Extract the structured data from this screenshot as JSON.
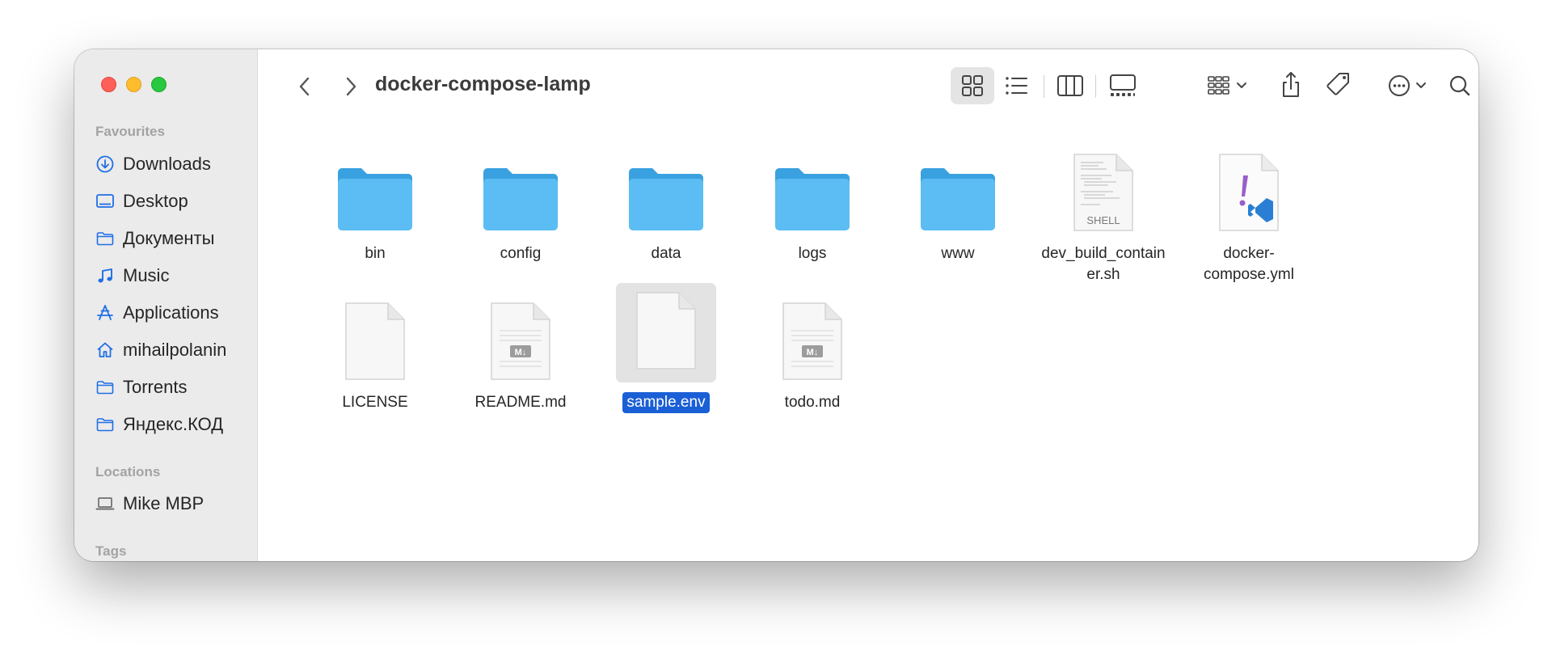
{
  "window": {
    "title": "docker-compose-lamp"
  },
  "sidebar": {
    "sections": [
      {
        "label": "Favourites"
      },
      {
        "label": "Locations"
      },
      {
        "label": "Tags"
      }
    ],
    "favourites": [
      {
        "label": "Downloads",
        "icon": "download-circle-icon"
      },
      {
        "label": "Desktop",
        "icon": "desktop-icon"
      },
      {
        "label": "Документы",
        "icon": "folder-icon"
      },
      {
        "label": "Music",
        "icon": "music-note-icon"
      },
      {
        "label": "Applications",
        "icon": "applications-icon"
      },
      {
        "label": "mihailpolanin",
        "icon": "home-icon"
      },
      {
        "label": "Torrents",
        "icon": "folder-icon"
      },
      {
        "label": "Яндекс.КОД",
        "icon": "folder-icon"
      }
    ],
    "locations": [
      {
        "label": "Mike MBP",
        "icon": "laptop-icon"
      }
    ]
  },
  "toolbar": {
    "icons": [
      "back-icon",
      "forward-icon",
      "icon-view-icon",
      "list-view-icon",
      "column-view-icon",
      "gallery-view-icon",
      "group-icon",
      "share-icon",
      "tag-icon",
      "more-icon",
      "search-icon"
    ],
    "active_view": "icon-view"
  },
  "files": [
    {
      "name": "bin",
      "kind": "folder"
    },
    {
      "name": "config",
      "kind": "folder"
    },
    {
      "name": "data",
      "kind": "folder"
    },
    {
      "name": "logs",
      "kind": "folder"
    },
    {
      "name": "www",
      "kind": "folder"
    },
    {
      "name": "dev_build_contain\ner.sh",
      "kind": "shell",
      "badge": "SHELL"
    },
    {
      "name": "docker-\ncompose.yml",
      "kind": "yml"
    },
    {
      "name": "LICENSE",
      "kind": "doc"
    },
    {
      "name": "README.md",
      "kind": "md",
      "badge": "M↓"
    },
    {
      "name": "sample.env",
      "kind": "doc",
      "selected": true
    },
    {
      "name": "todo.md",
      "kind": "md",
      "badge": "M↓"
    }
  ],
  "colors": {
    "folder": "#5bbdf3",
    "folder_tab": "#3aa1e0",
    "selection": "#1b5fd6",
    "sidebar_icon": "#1f6fe6"
  }
}
